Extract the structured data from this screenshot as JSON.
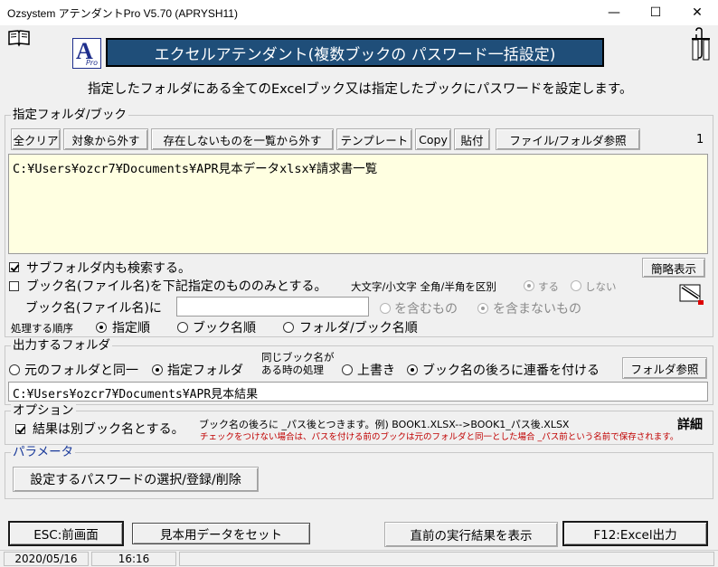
{
  "window": {
    "title": "Ozsystem アテンダントPro V5.70 (APRYSH11)",
    "min_glyph": "—",
    "max_glyph": "☐",
    "close_glyph": "✕"
  },
  "header": {
    "banner": "エクセルアテンダント(複数ブックの パスワード一括設定)",
    "logo_letter": "A",
    "logo_sub": "Pro",
    "description": "指定したフォルダにある全てのExcelブック又は指定したブックにパスワードを設定します。"
  },
  "folder_group": {
    "legend": "指定フォルダ/ブック",
    "buttons": {
      "clear_all": "全クリア",
      "exclude": "対象から外す",
      "remove_missing": "存在しないものを一覧から外す",
      "template": "テンプレート",
      "copy": "Copy",
      "paste": "貼付",
      "browse": "ファイル/フォルダ参照"
    },
    "count": "1",
    "path_list": "C:¥Users¥ozcr7¥Documents¥APR見本データxlsx¥請求書一覧",
    "search_subfolders": "サブフォルダ内も検索する。",
    "book_name_only": "ブック名(ファイル名)を下記指定のもののみとする。",
    "case_label": "大文字/小文字 全角/半角を区別",
    "case_yes": "する",
    "case_no": "しない",
    "book_name_label": "ブック名(ファイル名)に",
    "book_name_value": "",
    "include": "を含むもの",
    "exclude_match": "を含まないもの",
    "order_label": "処理する順序",
    "order_specified": "指定順",
    "order_book": "ブック名順",
    "order_folder_book": "フォルダ/ブック名順",
    "simple_view": "簡略表示"
  },
  "output_group": {
    "legend": "出力するフォルダ",
    "same_folder": "元のフォルダと同一",
    "specified_folder": "指定フォルダ",
    "same_name_line1": "同じブック名が",
    "same_name_line2": "ある時の処理",
    "overwrite": "上書き",
    "append_number": "ブック名の後ろに連番を付ける",
    "browse": "フォルダ参照",
    "path": "C:¥Users¥ozcr7¥Documents¥APR見本結果"
  },
  "option_group": {
    "legend": "オプション",
    "separate_name": "結果は別ブック名とする。",
    "note1": "ブック名の後ろに _パス後とつきます。例) BOOK1.XLSX-->BOOK1_パス後.XLSX",
    "note2": "チェックをつけない場合は、パスを付ける前のブックは元のフォルダと同一とした場合 _パス前という名前で保存されます。",
    "detail": "詳細"
  },
  "param_group": {
    "legend": "パラメータ",
    "password_button": "設定するパスワードの選択/登録/削除"
  },
  "footer": {
    "esc": "ESC:前画面",
    "sample": "見本用データをセット",
    "last_result": "直前の実行結果を表示",
    "f12": "F12:Excel出力"
  },
  "status": {
    "date": "2020/05/16",
    "time": "16:16"
  },
  "colors": {
    "banner_bg": "#1f4e79",
    "list_bg": "#ffffe1",
    "note_red": "#c00000",
    "legend_blue": "#1a3a9a"
  }
}
